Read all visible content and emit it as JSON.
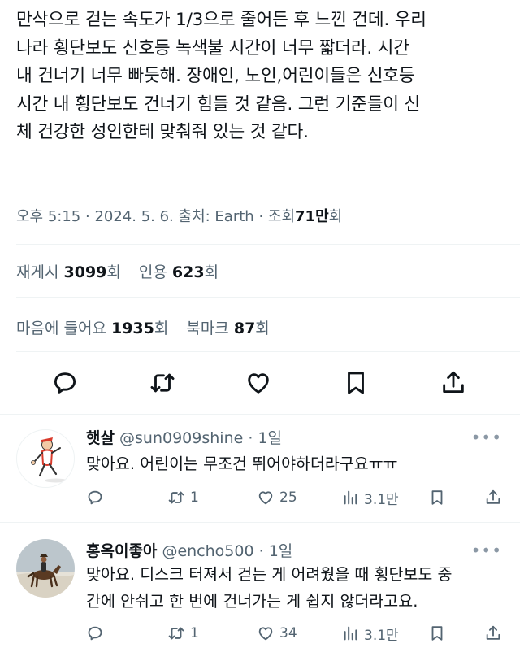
{
  "post": {
    "text_lines": [
      "만삭으로 걷는 속도가 1/3으로 줄어든 후 느낀 건데. 우리",
      "나라 횡단보도 신호등 녹색불 시간이 너무 짧더라. 시간",
      "내 건너기 너무 빠듯해. 장애인, 노인,어린이들은 신호등",
      "시간 내 횡단보도 건너기 힘들 것 같음. 그런 기준들이 신",
      "체 건강한 성인한테 맞춰줘 있는 것 같다."
    ],
    "time": "오후 5:15",
    "sep": "·",
    "date": "2024. 5. 6.",
    "source_label": "출처:",
    "source": "Earth",
    "views_label": "조회",
    "views_value": "71만",
    "views_unit": "회"
  },
  "stats": {
    "reposts_label": "재게시",
    "reposts_value": "3099",
    "quotes_label": "인용",
    "quotes_value": "623",
    "likes_label": "마음에 들어요",
    "likes_value": "1935",
    "bookmarks_label": "북마크",
    "bookmarks_value": "87",
    "unit": "회"
  },
  "actions": [
    "reply-icon",
    "repost-icon",
    "like-icon",
    "bookmark-icon",
    "share-icon"
  ],
  "replies": [
    {
      "name": "햇살",
      "handle": "@sun0909shine",
      "sep": "·",
      "time": "1일",
      "more": "•••",
      "text_lines": [
        "맞아요. 어린이는 무조건 뛰어야하더라구요ㅠㅠ"
      ],
      "reposts": "1",
      "likes": "25",
      "views": "3.1만"
    },
    {
      "name": "홍옥이좋아",
      "handle": "@encho500",
      "sep": "·",
      "time": "1일",
      "more": "•••",
      "text_lines": [
        "맞아요. 디스크 터져서 걷는 게 어려웠을 때 횡단보도 중",
        "간에 안쉬고 한 번에 건너가는 게 쉽지 않더라고요."
      ],
      "reposts": "1",
      "likes": "34",
      "views": "3.1만"
    }
  ],
  "colors": {
    "text": "#0f1419",
    "secondary": "#536471",
    "divider": "#eff3f4"
  }
}
